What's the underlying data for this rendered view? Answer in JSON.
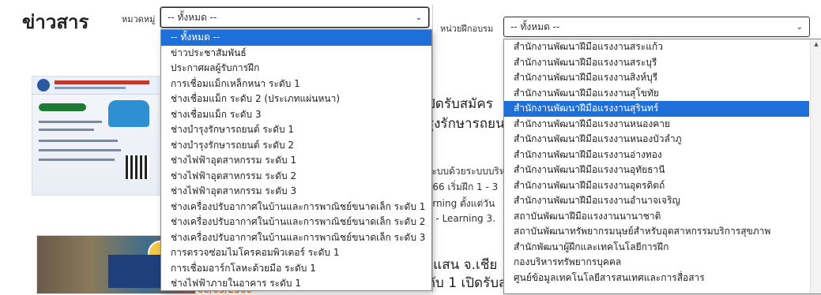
{
  "page": {
    "title": "ข่าวสาร"
  },
  "filters": {
    "category": {
      "label": "หมวดหมู่",
      "value": "-- ทั้งหมด --",
      "options": [
        "-- ทั้งหมด --",
        "ข่าวประชาสัมพันธ์",
        "ประกาศผลผู้รับการฝึก",
        "การเชื่อมแม็กเหล็กหนา ระดับ 1",
        "ช่างเชื่อมแม็ก ระดับ 2 (ประเภทแผ่นหนา)",
        "ช่างเชื่อมแม็ก ระดับ 3",
        "ช่างบำรุงรักษารถยนต์ ระดับ 1",
        "ช่างบำรุงรักษารถยนต์ ระดับ 2",
        "ช่างไฟฟ้าอุตสาหกรรม ระดับ 1",
        "ช่างไฟฟ้าอุตสาหกรรม ระดับ 2",
        "ช่างไฟฟ้าอุตสาหกรรม ระดับ 3",
        "ช่างเครื่องปรับอากาศในบ้านและการพาณิชย์ขนาดเล็ก ระดับ 1",
        "ช่างเครื่องปรับอากาศในบ้านและการพาณิชย์ขนาดเล็ก ระดับ 2",
        "ช่างเครื่องปรับอากาศในบ้านและการพาณิชย์ขนาดเล็ก ระดับ 3",
        "การตรวจซ่อมไมโครคอมพิวเตอร์ ระดับ 1",
        "การเชื่อมอาร์กโลหะด้วยมือ ระดับ 1",
        "ช่างไฟฟ้าภายในอาคาร ระดับ 1"
      ],
      "selected_index": 0
    },
    "unit": {
      "label": "หน่วยฝึกอบรม",
      "value": "-- ทั้งหมด --",
      "options": [
        "สำนักงานพัฒนาฝีมือแรงงานสระแก้ว",
        "สำนักงานพัฒนาฝีมือแรงงานสระบุรี",
        "สำนักงานพัฒนาฝีมือแรงงานสิงห์บุรี",
        "สำนักงานพัฒนาฝีมือแรงงานสุโขทัย",
        "สำนักงานพัฒนาฝีมือแรงงานสุรินทร์",
        "สำนักงานพัฒนาฝีมือแรงงานหนองคาย",
        "สำนักงานพัฒนาฝีมือแรงงานหนองบัวลำภู",
        "สำนักงานพัฒนาฝีมือแรงงานอ่างทอง",
        "สำนักงานพัฒนาฝีมือแรงงานอุทัยธานี",
        "สำนักงานพัฒนาฝีมือแรงงานอุตรดิตถ์",
        "สำนักงานพัฒนาฝีมือแรงงานอำนาจเจริญ",
        "สถาบันพัฒนาฝีมือแรงงานนานาชาติ",
        "สถาบันพัฒนาทรัพยากรมนุษย์สำหรับอุตสาหกรรมบริการสุขภาพ",
        "สำนักพัฒนาผู้ฝึกและเทคโนโลยีการฝึก",
        "กองบริหารทรัพยากรบุคคล",
        "ศูนย์ข้อมูลเทคโนโลยีสารสนเทศและการสื่อสาร"
      ],
      "selected_index": 4
    }
  },
  "news": {
    "item1": {
      "title_a": "ปิดรับสมัคร",
      "title_b": "รุงรักษารถยน",
      "line1": "ระบบด้วยระบบบริห",
      "line2": "e66 เริ่มฝึก 1 - 3",
      "line3": "arning ตั้งแต่วัน",
      "line4": "n - Learning 3."
    },
    "item2": {
      "title_a": "งแสน จ.เชีย",
      "title_b": "ดับ 1 เปิดรับส",
      "date": "08/05/2566"
    }
  },
  "icons": {
    "chevron": "chevron-down-icon"
  },
  "colors": {
    "selected_bg": "#1e6fd9",
    "date": "#d35400"
  }
}
